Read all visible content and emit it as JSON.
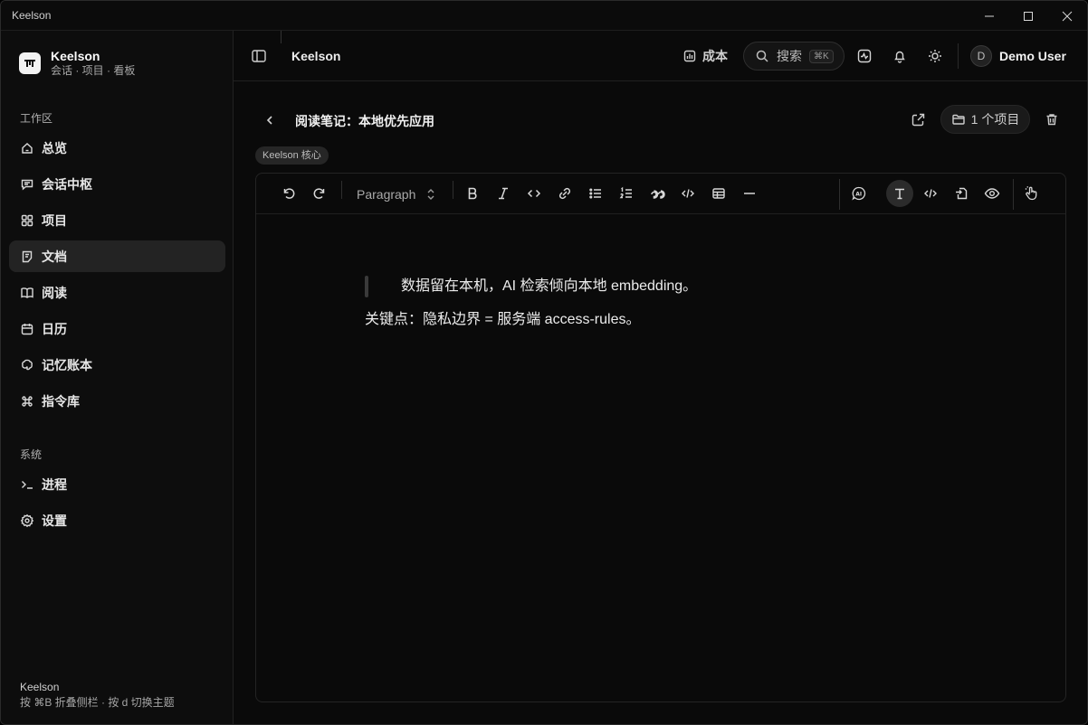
{
  "window": {
    "title": "Keelson"
  },
  "brand": {
    "name": "Keelson",
    "subtitle": "会话 · 项目 · 看板"
  },
  "sidebar": {
    "workspace_label": "工作区",
    "items": [
      {
        "label": "总览",
        "icon": "home-icon"
      },
      {
        "label": "会话中枢",
        "icon": "chat-icon"
      },
      {
        "label": "项目",
        "icon": "grid-icon"
      },
      {
        "label": "文档",
        "icon": "document-icon",
        "active": true
      },
      {
        "label": "阅读",
        "icon": "book-icon"
      },
      {
        "label": "日历",
        "icon": "calendar-icon"
      },
      {
        "label": "记忆账本",
        "icon": "brain-icon"
      },
      {
        "label": "指令库",
        "icon": "command-icon"
      }
    ],
    "system_label": "系统",
    "system_items": [
      {
        "label": "进程",
        "icon": "terminal-icon"
      },
      {
        "label": "设置",
        "icon": "gear-icon"
      }
    ],
    "footer_title": "Keelson",
    "footer_hint": "按 ⌘B 折叠侧栏 · 按 d 切换主题"
  },
  "topbar": {
    "title": "Keelson",
    "cost_label": "成本",
    "search_label": "搜索",
    "search_shortcut": "⌘K",
    "user_initial": "D",
    "user_name": "Demo User"
  },
  "document": {
    "title": "阅读笔记：本地优先应用",
    "project_count_label": "1 个项目",
    "tag": "Keelson 核心",
    "block_type": "Paragraph",
    "quote": "数据留在本机，AI 检索倾向本地 embedding。",
    "paragraph": "关键点：隐私边界 = 服务端 access-rules。"
  }
}
